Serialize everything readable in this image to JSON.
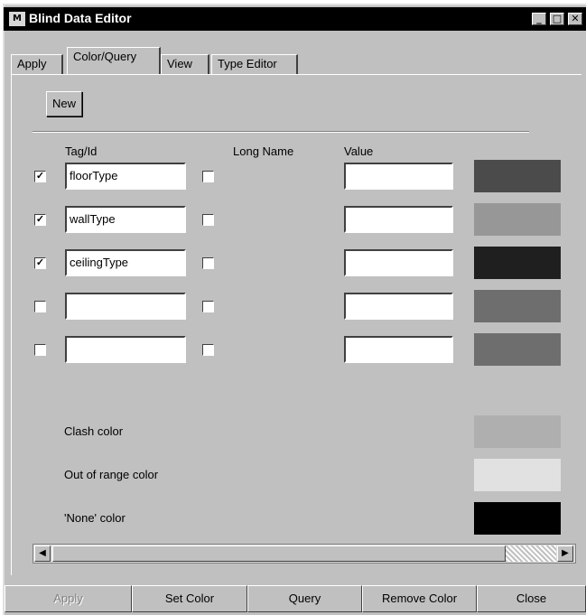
{
  "window": {
    "title": "Blind Data Editor",
    "app_icon": "M"
  },
  "window_controls": [
    "minimize-icon",
    "maximize-icon",
    "close-icon"
  ],
  "tabs": [
    {
      "label": "Apply",
      "active": false
    },
    {
      "label": "Color/Query",
      "active": true
    },
    {
      "label": "View",
      "active": false
    },
    {
      "label": "Type Editor",
      "active": false
    }
  ],
  "panel": {
    "new_label": "New",
    "headers": {
      "tag": "Tag/Id",
      "long_name": "Long Name",
      "value": "Value"
    },
    "rows": [
      {
        "checked": true,
        "tag": "floorType",
        "long_checked": false,
        "value": "",
        "color": "#4b4b4b"
      },
      {
        "checked": true,
        "tag": "wallType",
        "long_checked": false,
        "value": "",
        "color": "#979797"
      },
      {
        "checked": true,
        "tag": "ceilingType",
        "long_checked": false,
        "value": "",
        "color": "#1f1f1f"
      },
      {
        "checked": false,
        "tag": "",
        "long_checked": false,
        "value": "",
        "color": "#6e6e6e"
      },
      {
        "checked": false,
        "tag": "",
        "long_checked": false,
        "value": "",
        "color": "#6e6e6e"
      }
    ],
    "special_colors": [
      {
        "label": "Clash color",
        "color": "#afafaf"
      },
      {
        "label": "Out of range color",
        "color": "#e1e1e1"
      },
      {
        "label": "'None' color",
        "color": "#000000"
      }
    ]
  },
  "bottom_buttons": [
    {
      "label": "Apply",
      "disabled": true
    },
    {
      "label": "Set Color",
      "disabled": false
    },
    {
      "label": "Query",
      "disabled": false
    },
    {
      "label": "Remove Color",
      "disabled": false
    },
    {
      "label": "Close",
      "disabled": false
    }
  ]
}
